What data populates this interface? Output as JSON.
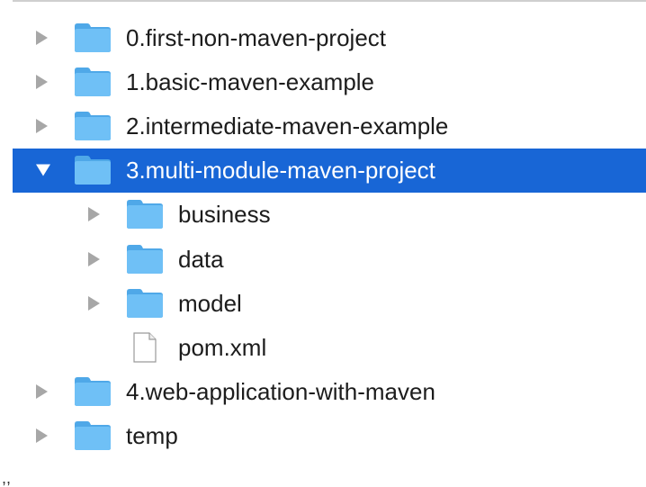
{
  "tree": {
    "items": [
      {
        "label": "0.first-non-maven-project",
        "type": "folder",
        "icon": "folder-icon",
        "level": 0,
        "expandable": true,
        "expanded": false,
        "selected": false
      },
      {
        "label": "1.basic-maven-example",
        "type": "folder",
        "icon": "folder-icon",
        "level": 0,
        "expandable": true,
        "expanded": false,
        "selected": false
      },
      {
        "label": "2.intermediate-maven-example",
        "type": "folder",
        "icon": "folder-icon",
        "level": 0,
        "expandable": true,
        "expanded": false,
        "selected": false
      },
      {
        "label": "3.multi-module-maven-project",
        "type": "folder",
        "icon": "folder-icon",
        "level": 0,
        "expandable": true,
        "expanded": true,
        "selected": true
      },
      {
        "label": "business",
        "type": "folder",
        "icon": "folder-icon",
        "level": 1,
        "expandable": true,
        "expanded": false,
        "selected": false
      },
      {
        "label": "data",
        "type": "folder",
        "icon": "folder-icon",
        "level": 1,
        "expandable": true,
        "expanded": false,
        "selected": false
      },
      {
        "label": "model",
        "type": "folder",
        "icon": "folder-icon",
        "level": 1,
        "expandable": true,
        "expanded": false,
        "selected": false
      },
      {
        "label": "pom.xml",
        "type": "file",
        "icon": "file-icon",
        "level": 1,
        "expandable": false,
        "expanded": false,
        "selected": false
      },
      {
        "label": "4.web-application-with-maven",
        "type": "folder",
        "icon": "folder-icon",
        "level": 0,
        "expandable": true,
        "expanded": false,
        "selected": false
      },
      {
        "label": "temp",
        "type": "folder",
        "icon": "folder-icon",
        "level": 0,
        "expandable": true,
        "expanded": false,
        "selected": false
      }
    ]
  },
  "colors": {
    "selection": "#1866d6",
    "folder": "#5ab4f0",
    "arrow": "#a7a7a7"
  },
  "stray_mark": ",,"
}
